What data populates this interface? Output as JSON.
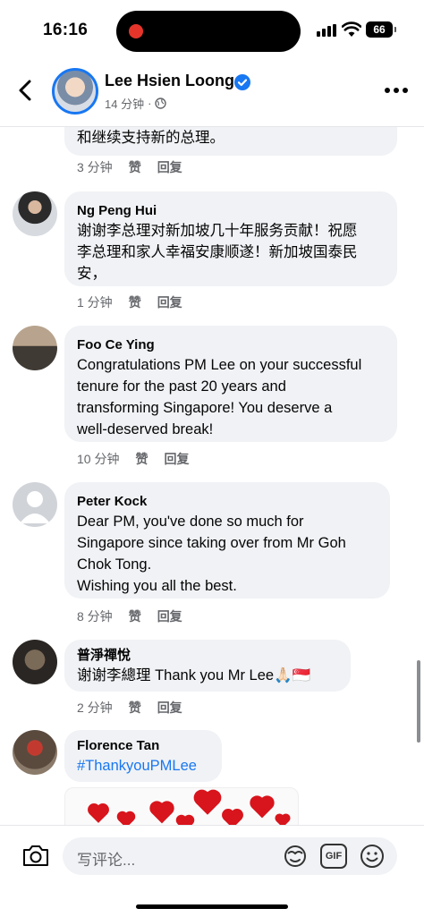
{
  "status_bar": {
    "time": "16:16",
    "battery": "66"
  },
  "header": {
    "page_name": "Lee Hsien Loong",
    "timestamp": "14 分钟"
  },
  "partial_comment": {
    "text": "和继续支持新的总理。",
    "time": "3 分钟",
    "like": "赞",
    "reply": "回复"
  },
  "comments": [
    {
      "name": "Ng Peng Hui",
      "text": "谢谢李总理对新加坡几十年服务贡献！祝愿\n李总理和家人幸福安康顺遂！新加坡国泰民\n安，",
      "time": "1 分钟",
      "like": "赞",
      "reply": "回复"
    },
    {
      "name": "Foo Ce Ying",
      "text": "Congratulations PM Lee on your successful\ntenure for the past 20 years and\ntransforming Singapore! You deserve a\nwell-deserved break!",
      "time": "10 分钟",
      "like": "赞",
      "reply": "回复"
    },
    {
      "name": "Peter Kock",
      "text": "Dear PM, you've done so much for\nSingapore since taking over from Mr Goh\nChok Tong.\nWishing you all the best.",
      "time": "8 分钟",
      "like": "赞",
      "reply": "回复"
    },
    {
      "name": "普淨禪悅",
      "text": "谢谢李總理 Thank you Mr Lee🙏🏻🇸🇬",
      "time": "2 分钟",
      "like": "赞",
      "reply": "回复"
    },
    {
      "name": "Florence Tan",
      "text": "#ThankyouPMLee"
    }
  ],
  "composer": {
    "placeholder": "写评论...",
    "gif_label": "GIF"
  },
  "colors": {
    "accent": "#1877f2",
    "bubble": "#f0f2f5",
    "secondary_text": "#65676b"
  },
  "icons": [
    "back-icon",
    "verified-icon",
    "globe-icon",
    "more-icon",
    "camera-icon",
    "avatar-sticker-icon",
    "gif-icon",
    "emoji-icon"
  ]
}
